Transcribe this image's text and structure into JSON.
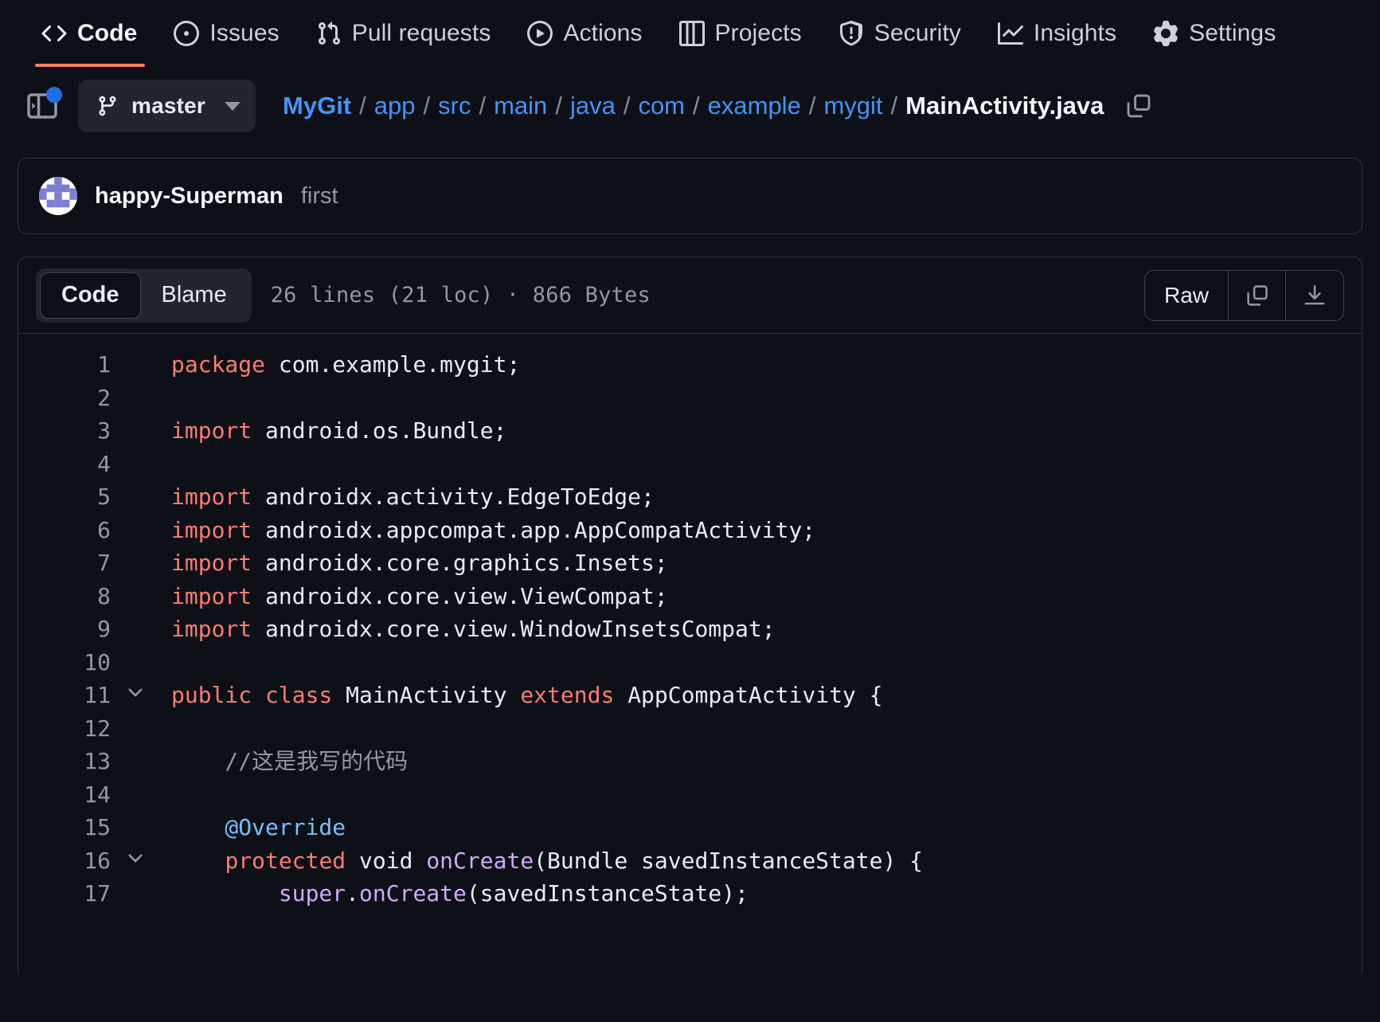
{
  "repo_nav": {
    "items": [
      {
        "label": "Code",
        "icon": "code-icon",
        "active": true
      },
      {
        "label": "Issues",
        "icon": "issue-opened-icon",
        "active": false
      },
      {
        "label": "Pull requests",
        "icon": "git-pull-request-icon",
        "active": false
      },
      {
        "label": "Actions",
        "icon": "play-icon",
        "active": false
      },
      {
        "label": "Projects",
        "icon": "table-icon",
        "active": false
      },
      {
        "label": "Security",
        "icon": "shield-icon",
        "active": false
      },
      {
        "label": "Insights",
        "icon": "graph-icon",
        "active": false
      },
      {
        "label": "Settings",
        "icon": "gear-icon",
        "active": false
      }
    ]
  },
  "file_header": {
    "sidebar_toggle_icon": "sidebar-expand-icon",
    "branch": "master",
    "branch_icon": "git-branch-icon",
    "breadcrumb": {
      "repo": "MyGit",
      "path": [
        "app",
        "src",
        "main",
        "java",
        "com",
        "example",
        "mygit"
      ],
      "file": "MainActivity.java",
      "separator": "/"
    },
    "copy_path_icon": "copy-icon"
  },
  "latest_commit": {
    "author": "happy-Superman",
    "message": "first"
  },
  "code_toolbar": {
    "tabs": [
      {
        "label": "Code",
        "active": true
      },
      {
        "label": "Blame",
        "active": false
      }
    ],
    "file_meta": "26 lines (21 loc) · 866 Bytes",
    "raw_label": "Raw",
    "copy_icon": "copy-icon",
    "download_icon": "download-icon"
  },
  "code": {
    "language": "java",
    "lines": [
      {
        "n": 1,
        "fold": false,
        "tokens": [
          {
            "t": "package",
            "c": "k"
          },
          {
            "t": " com.example.mygit;",
            "c": "id"
          }
        ]
      },
      {
        "n": 2,
        "fold": false,
        "tokens": []
      },
      {
        "n": 3,
        "fold": false,
        "tokens": [
          {
            "t": "import",
            "c": "k"
          },
          {
            "t": " android.os.Bundle;",
            "c": "id"
          }
        ]
      },
      {
        "n": 4,
        "fold": false,
        "tokens": []
      },
      {
        "n": 5,
        "fold": false,
        "tokens": [
          {
            "t": "import",
            "c": "k"
          },
          {
            "t": " androidx.activity.EdgeToEdge;",
            "c": "id"
          }
        ]
      },
      {
        "n": 6,
        "fold": false,
        "tokens": [
          {
            "t": "import",
            "c": "k"
          },
          {
            "t": " androidx.appcompat.app.AppCompatActivity;",
            "c": "id"
          }
        ]
      },
      {
        "n": 7,
        "fold": false,
        "tokens": [
          {
            "t": "import",
            "c": "k"
          },
          {
            "t": " androidx.core.graphics.Insets;",
            "c": "id"
          }
        ]
      },
      {
        "n": 8,
        "fold": false,
        "tokens": [
          {
            "t": "import",
            "c": "k"
          },
          {
            "t": " androidx.core.view.ViewCompat;",
            "c": "id"
          }
        ]
      },
      {
        "n": 9,
        "fold": false,
        "tokens": [
          {
            "t": "import",
            "c": "k"
          },
          {
            "t": " androidx.core.view.WindowInsetsCompat;",
            "c": "id"
          }
        ]
      },
      {
        "n": 10,
        "fold": false,
        "tokens": []
      },
      {
        "n": 11,
        "fold": true,
        "tokens": [
          {
            "t": "public",
            "c": "k"
          },
          {
            "t": " ",
            "c": "id"
          },
          {
            "t": "class",
            "c": "k"
          },
          {
            "t": " MainActivity ",
            "c": "id"
          },
          {
            "t": "extends",
            "c": "k"
          },
          {
            "t": " AppCompatActivity {",
            "c": "id"
          }
        ]
      },
      {
        "n": 12,
        "fold": false,
        "tokens": []
      },
      {
        "n": 13,
        "fold": false,
        "tokens": [
          {
            "t": "    //这是我写的代码",
            "c": "cm"
          }
        ]
      },
      {
        "n": 14,
        "fold": false,
        "tokens": []
      },
      {
        "n": 15,
        "fold": false,
        "tokens": [
          {
            "t": "    @Override",
            "c": "an"
          }
        ]
      },
      {
        "n": 16,
        "fold": true,
        "tokens": [
          {
            "t": "    ",
            "c": "id"
          },
          {
            "t": "protected",
            "c": "k"
          },
          {
            "t": " void ",
            "c": "id"
          },
          {
            "t": "onCreate",
            "c": "fn"
          },
          {
            "t": "(Bundle savedInstanceState) {",
            "c": "id"
          }
        ]
      },
      {
        "n": 17,
        "fold": false,
        "tokens": [
          {
            "t": "        ",
            "c": "id"
          },
          {
            "t": "super",
            "c": "fn"
          },
          {
            "t": ".",
            "c": "id"
          },
          {
            "t": "onCreate",
            "c": "fn"
          },
          {
            "t": "(savedInstanceState);",
            "c": "id"
          }
        ]
      }
    ]
  },
  "colors": {
    "background": "#0d1117",
    "border": "#30363d",
    "link": "#4493f8",
    "muted": "#9198a1",
    "accent_underline": "#f78166",
    "keyword": "#ff7b72",
    "function": "#d2a8ff",
    "annotation": "#79c0ff",
    "text": "#e6edf3",
    "badge_dot": "#1f6feb"
  }
}
